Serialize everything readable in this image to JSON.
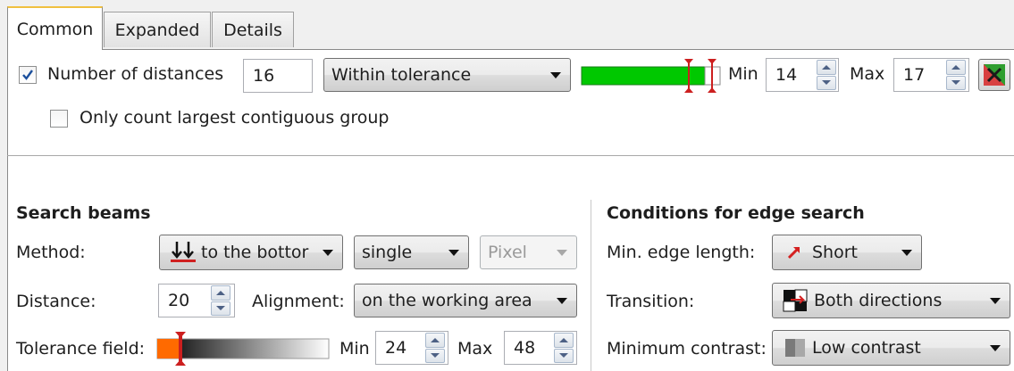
{
  "tabs": [
    {
      "label": "Common"
    },
    {
      "label": "Expanded"
    },
    {
      "label": "Details"
    }
  ],
  "count": {
    "checkbox_label": "Number of distances",
    "checked": true,
    "value": "16",
    "mode": "Within tolerance",
    "min_label": "Min",
    "min_value": "14",
    "max_label": "Max",
    "max_value": "17",
    "bar_color": "#00c800"
  },
  "contiguous": {
    "checkbox_label": "Only count largest contiguous group",
    "checked": false
  },
  "search_beams": {
    "heading": "Search beams",
    "method_label": "Method:",
    "method_value": "to the bottor",
    "method_icon": "arrows-down-icon",
    "beam_mode": "single",
    "unit": "Pixel",
    "distance_label": "Distance:",
    "distance_value": "20",
    "alignment_label": "Alignment:",
    "alignment_value": "on the working area",
    "tolerance_label": "Tolerance field:",
    "min_label": "Min",
    "min_value": "24",
    "max_label": "Max",
    "max_value": "48",
    "accent": "#ff6a00"
  },
  "edge_search": {
    "heading": "Conditions for edge search",
    "edge_length_label": "Min. edge length:",
    "edge_length_value": "Short",
    "transition_label": "Transition:",
    "transition_value": "Both directions",
    "contrast_label": "Minimum contrast:",
    "contrast_value": "Low contrast"
  }
}
